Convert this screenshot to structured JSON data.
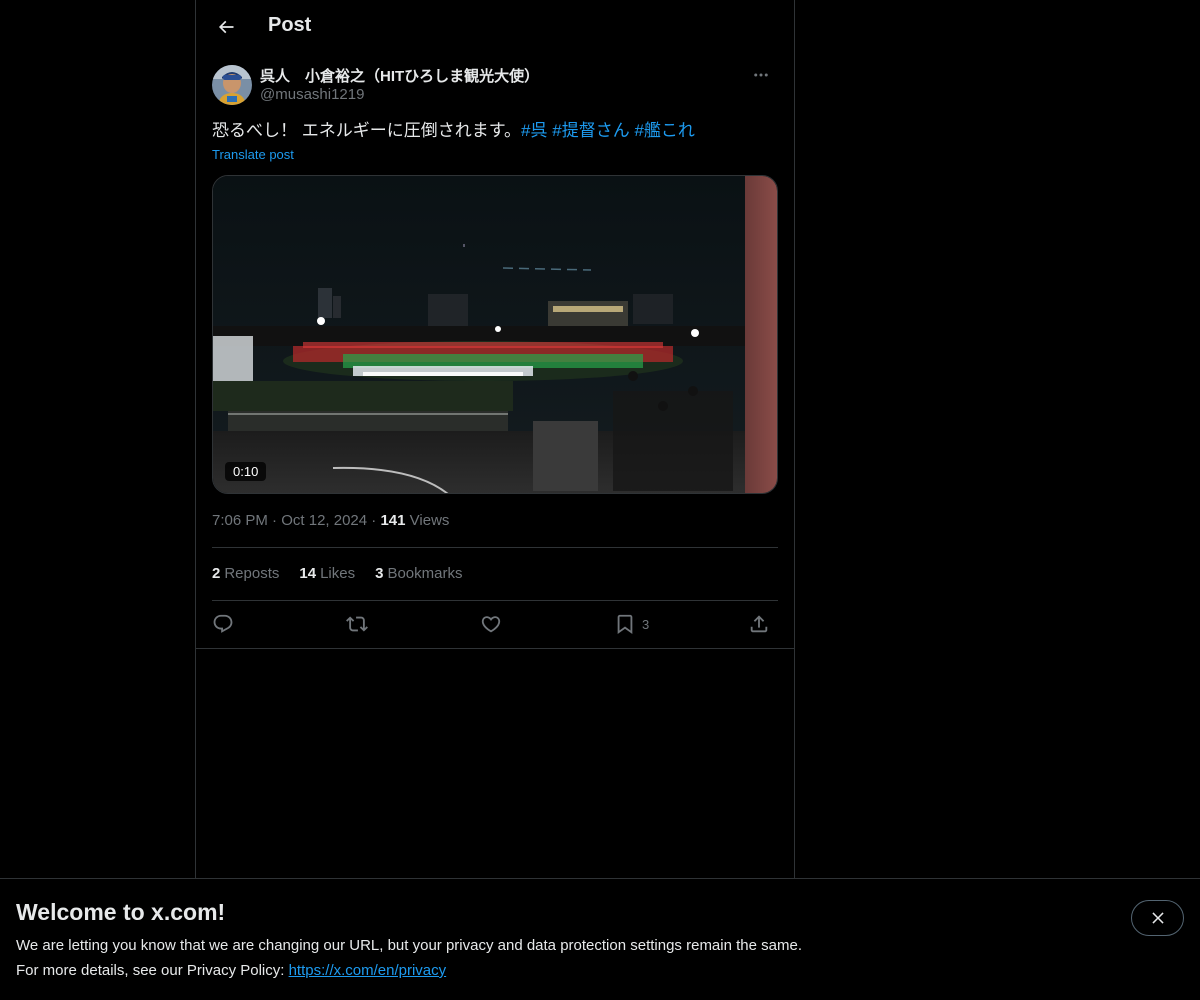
{
  "header": {
    "title": "Post"
  },
  "author": {
    "name": "呉人　小倉裕之（HITひろしま観光大使）",
    "handle": "@musashi1219"
  },
  "tweet": {
    "text": "恐るべし！ エネルギーに圧倒されます。",
    "hashtags": [
      "#呉",
      "#提督さん",
      "#艦これ"
    ],
    "translate_label": "Translate post"
  },
  "media": {
    "duration": "0:10"
  },
  "meta": {
    "time": "7:06 PM",
    "separator": "·",
    "date": "Oct 12, 2024",
    "views_count": "141",
    "views_label": "Views"
  },
  "stats": {
    "reposts_count": "2",
    "reposts_label": "Reposts",
    "likes_count": "14",
    "likes_label": "Likes",
    "bookmarks_count": "3",
    "bookmarks_label": "Bookmarks"
  },
  "actions": {
    "bookmark_count": "3"
  },
  "banner": {
    "title": "Welcome to x.com!",
    "line1": "We are letting you know that we are changing our URL, but your privacy and data protection settings remain the same.",
    "line2_prefix": "For more details, see our Privacy Policy: ",
    "link": "https://x.com/en/privacy"
  },
  "colors": {
    "accent": "#1d9bf0",
    "muted": "#71767b",
    "border": "#2f3336",
    "text": "#e7e9ea",
    "background": "#000000"
  },
  "icons": [
    "arrow-left-icon",
    "more-icon",
    "reply-icon",
    "repost-icon",
    "like-icon",
    "bookmark-icon",
    "share-icon",
    "close-icon"
  ]
}
